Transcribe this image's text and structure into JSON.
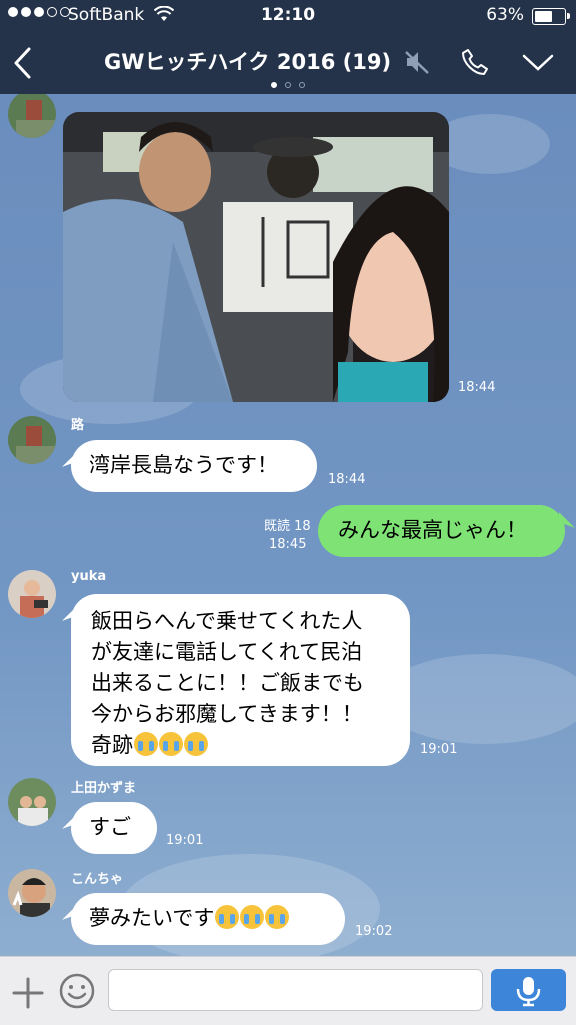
{
  "status_bar": {
    "carrier": "SoftBank",
    "time": "12:10",
    "battery": "63%",
    "battery_level": 0.63
  },
  "header": {
    "back_icon": "chevron-left-icon",
    "title": "GWヒッチハイク 2016 (19)",
    "mute_icon": "muted-speaker-icon",
    "call_icon": "phone-icon",
    "menu_icon": "chevron-down-icon",
    "page_dots": 3,
    "active_page": 1
  },
  "messages": [
    {
      "type": "image",
      "sender": "路",
      "time": "18:44",
      "description": "photo-in-car"
    },
    {
      "type": "text",
      "sender": "路",
      "text": "湾岸長島なうです！",
      "time": "18:44"
    },
    {
      "type": "text",
      "mine": true,
      "read": "既読 18",
      "text": "みんな最高じゃん！",
      "time": "18:45"
    },
    {
      "type": "text",
      "sender": "yuka",
      "lines": [
        "飯田らへんで乗せてくれた人",
        "が友達に電話してくれて民泊",
        "出来ることに！！ご飯までも",
        "今からお邪魔してきます！！",
        "奇跡"
      ],
      "emoji": "crying-face-icon",
      "emoji_count": 3,
      "time": "19:01"
    },
    {
      "type": "text",
      "sender": "上田かずま",
      "text": "すご",
      "time": "19:01"
    },
    {
      "type": "text",
      "sender": "こんちゃ",
      "text": "夢みたいです",
      "emoji": "crying-face-icon",
      "emoji_count": 3,
      "time": "19:02"
    }
  ],
  "input_bar": {
    "plus_icon": "plus-icon",
    "emoji_icon": "smiley-icon",
    "placeholder": "",
    "mic_icon": "microphone-icon"
  },
  "colors": {
    "header_bg": "#243349",
    "chat_bg": "#6f8fba",
    "my_bubble": "#7ee374",
    "other_bubble": "#ffffff",
    "mic_button": "#3d85d8"
  }
}
